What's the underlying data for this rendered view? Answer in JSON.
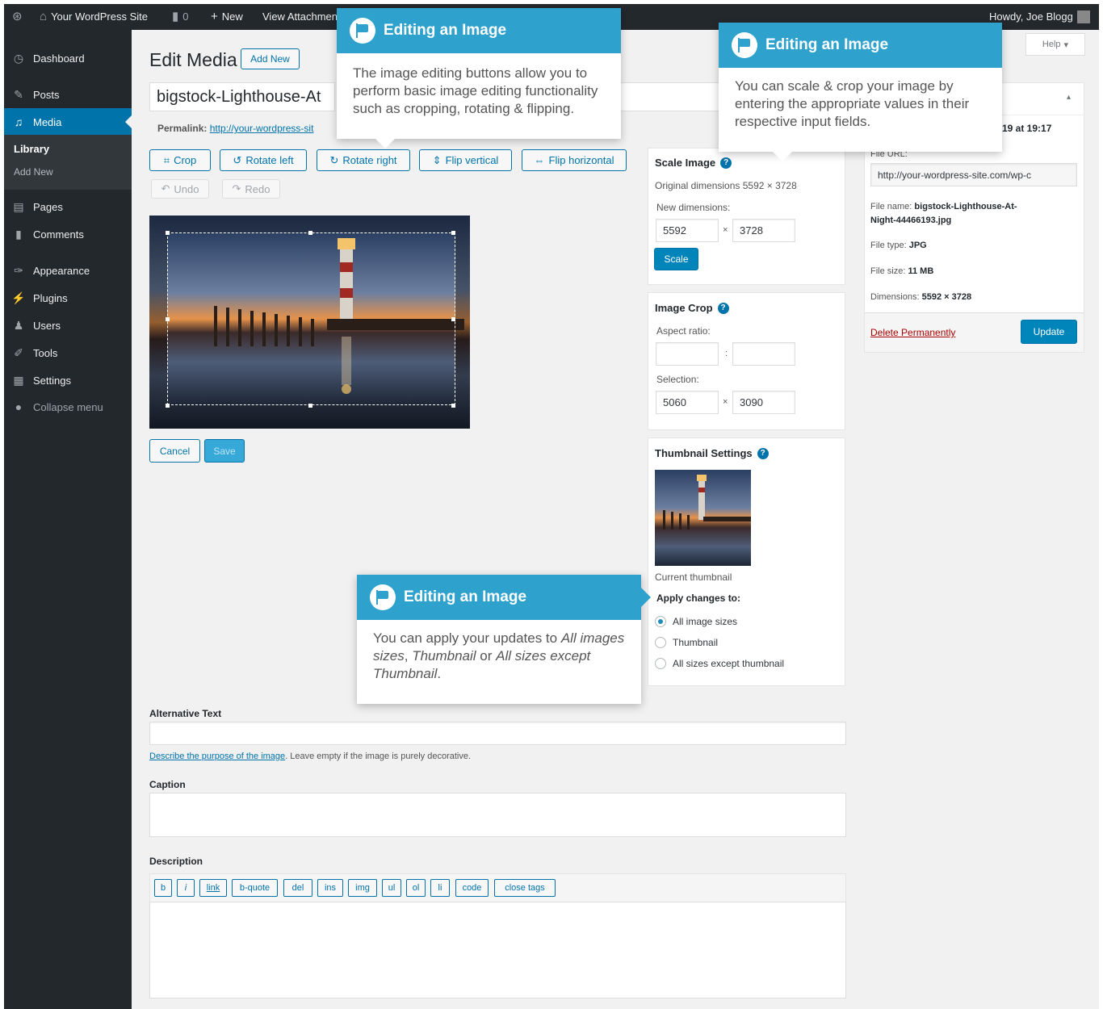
{
  "adminbar": {
    "site_name": "Your WordPress Site",
    "comments_count": "0",
    "new_label": "New",
    "view_label": "View Attachment",
    "howdy": "Howdy, Joe Blogg",
    "help_label": "Help"
  },
  "sidebar": {
    "items": [
      {
        "label": "Dashboard",
        "icon": "dashboard-icon"
      },
      {
        "label": "Posts",
        "icon": "pin-icon"
      },
      {
        "label": "Media",
        "icon": "media-icon"
      },
      {
        "label": "Pages",
        "icon": "pages-icon"
      },
      {
        "label": "Comments",
        "icon": "comments-icon"
      },
      {
        "label": "Appearance",
        "icon": "brush-icon"
      },
      {
        "label": "Plugins",
        "icon": "plugin-icon"
      },
      {
        "label": "Users",
        "icon": "users-icon"
      },
      {
        "label": "Tools",
        "icon": "wrench-icon"
      },
      {
        "label": "Settings",
        "icon": "settings-icon"
      },
      {
        "label": "Collapse menu",
        "icon": "collapse-icon"
      }
    ],
    "submenu": {
      "library": "Library",
      "add_new": "Add New"
    }
  },
  "header": {
    "title": "Edit Media",
    "add_new": "Add New"
  },
  "media": {
    "title_value": "bigstock-Lighthouse-At",
    "permalink_label": "Permalink:",
    "permalink_url": "http://your-wordpress-sit"
  },
  "toolbar": {
    "crop": "Crop",
    "rotate_left": "Rotate left",
    "rotate_right": "Rotate right",
    "flip_vertical": "Flip vertical",
    "flip_horizontal": "Flip horizontal",
    "undo": "Undo",
    "redo": "Redo",
    "cancel": "Cancel",
    "save": "Save"
  },
  "scale": {
    "title": "Scale Image",
    "original": "Original dimensions 5592 × 3728",
    "new_dimensions": "New dimensions:",
    "width": "5592",
    "height": "3728",
    "times": "×",
    "button": "Scale"
  },
  "crop": {
    "title": "Image Crop",
    "aspect_ratio": "Aspect ratio:",
    "colon": ":",
    "selection": "Selection:",
    "sel_width": "5060",
    "sel_height": "3090",
    "times": "×"
  },
  "thumbnail": {
    "title": "Thumbnail Settings",
    "current": "Current thumbnail",
    "apply_to": "Apply changes to:",
    "options": [
      "All image sizes",
      "Thumbnail",
      "All sizes except thumbnail"
    ],
    "selected": "All image sizes"
  },
  "sidepanel": {
    "uploaded_suffix": "19 at 19:17",
    "file_url_label": "File URL:",
    "file_url": "http://your-wordpress-site.com/wp-c",
    "file_name_label": "File name:",
    "file_name_1": "bigstock-Lighthouse-At-",
    "file_name_2": "Night-44466193.jpg",
    "file_type_label": "File type:",
    "file_type": "JPG",
    "file_size_label": "File size:",
    "file_size": "11 MB",
    "dimensions_label": "Dimensions:",
    "dimensions": "5592 × 3728",
    "delete": "Delete Permanently",
    "update": "Update"
  },
  "fields": {
    "alt_text": "Alternative Text",
    "alt_help_link": "Describe the purpose of the image",
    "alt_help_rest": ". Leave empty if the image is purely decorative.",
    "caption": "Caption",
    "description": "Description",
    "quicktags": [
      "b",
      "i",
      "link",
      "b-quote",
      "del",
      "ins",
      "img",
      "ul",
      "ol",
      "li",
      "code",
      "close tags"
    ]
  },
  "pointers": {
    "p1": {
      "title": "Editing an Image",
      "body": "The image editing buttons allow you to perform basic image editing functionality such as cropping, rotating & flipping."
    },
    "p2": {
      "title": "Editing an Image",
      "body": "You can scale & crop your image by entering the appropriate values in their respective input fields."
    },
    "p3": {
      "title": "Editing an Image",
      "body_1": "You can apply your updates to ",
      "body_2": "All images sizes",
      "body_3": ", ",
      "body_4": "Thumbnail",
      "body_5": " or ",
      "body_6": "All sizes except Thumbnail",
      "body_7": "."
    }
  },
  "colors": {
    "accent": "#0073aa",
    "pointer": "#2ea2cc",
    "sidebar": "#23282d"
  }
}
